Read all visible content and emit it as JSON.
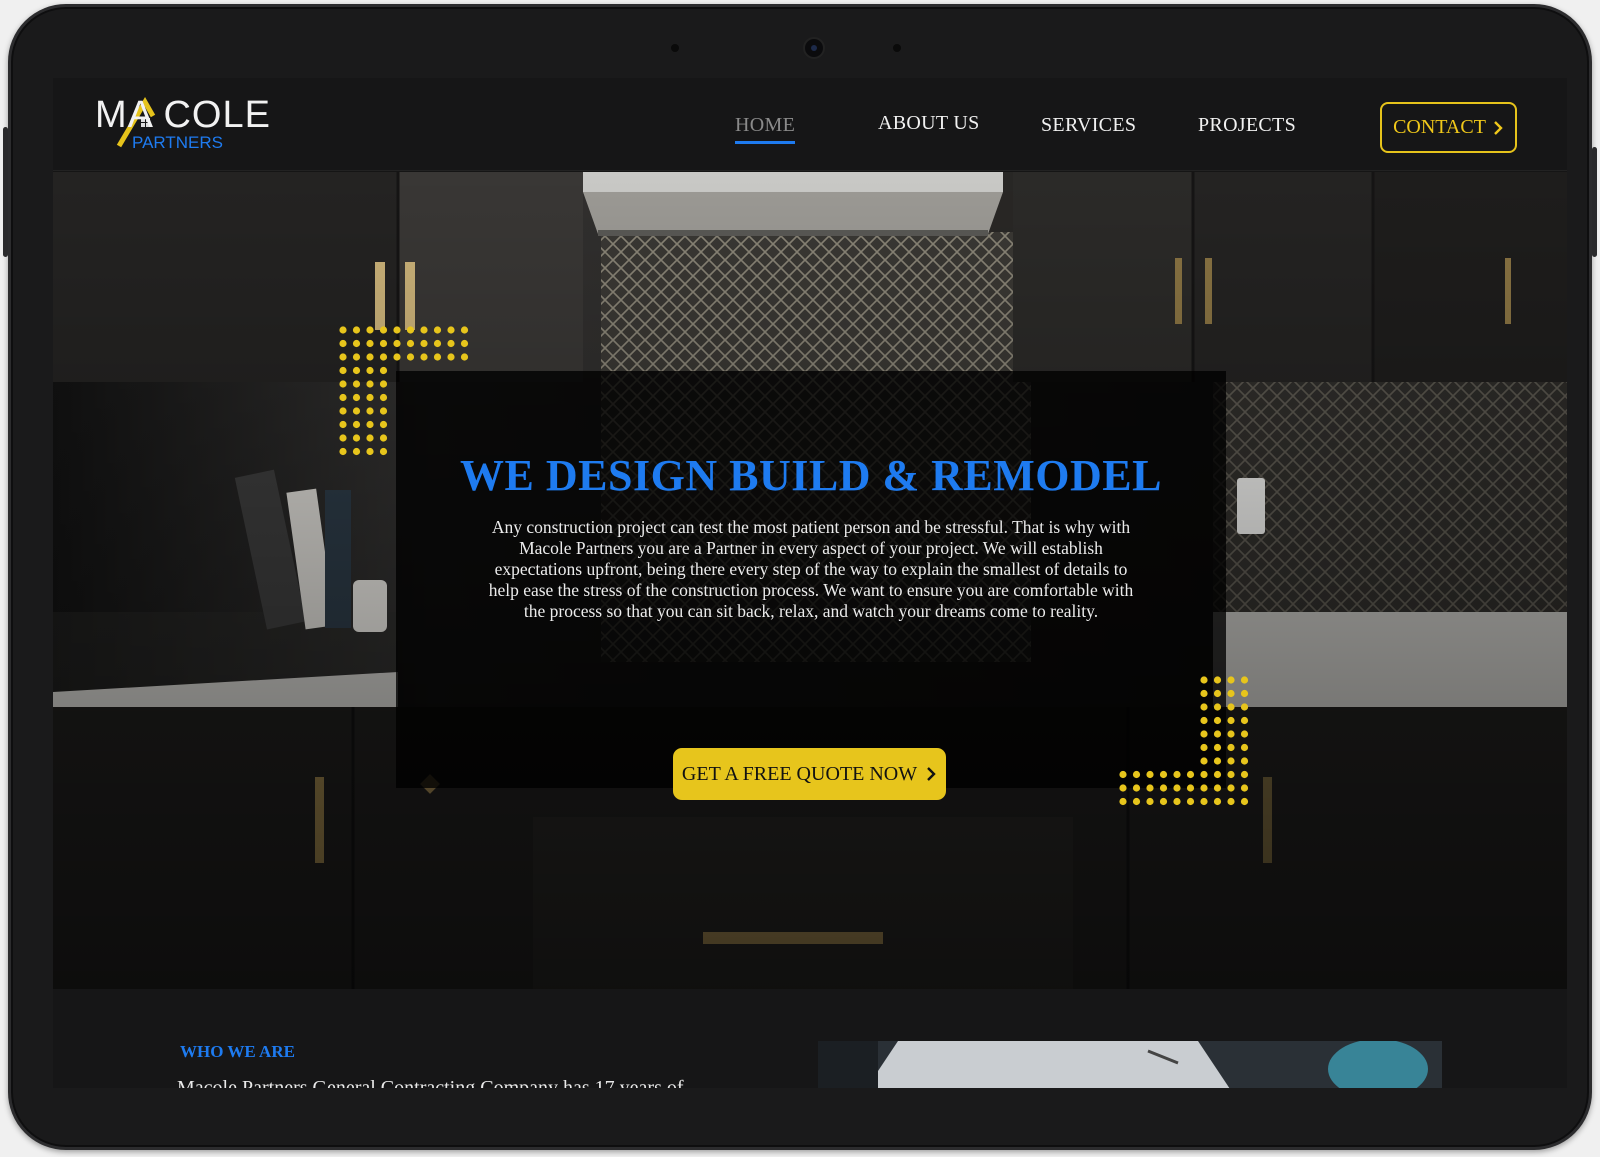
{
  "logo": {
    "main": "MA COLE",
    "sub": "PARTNERS"
  },
  "nav": {
    "items": [
      {
        "label": "HOME",
        "active": true
      },
      {
        "label": "ABOUT US",
        "active": false
      },
      {
        "label": "SERVICES",
        "active": false
      },
      {
        "label": "PROJECTS",
        "active": false
      }
    ],
    "contact_label": "CONTACT"
  },
  "hero": {
    "title": "WE DESIGN BUILD & REMODEL",
    "text": "Any construction project can test the most patient person and be stressful. That is why with Macole Partners you are a Partner in every aspect of your project. We will establish expectations upfront, being there every step of the way to explain the smallest of details to help ease the stress of the construction process. We want to ensure you are comfortable with the process so that you can sit back, relax, and watch your dreams come to reality.",
    "cta_label": "GET A FREE QUOTE NOW"
  },
  "about": {
    "eyebrow": "WHO WE ARE",
    "text": "Macole Partners General Contracting Company has 17 years of"
  },
  "colors": {
    "accent_blue": "#1e7bf0",
    "accent_yellow": "#e7c51c",
    "background": "#161617"
  },
  "icons": {
    "contact": "chevron-right-icon",
    "cta": "chevron-right-icon"
  }
}
